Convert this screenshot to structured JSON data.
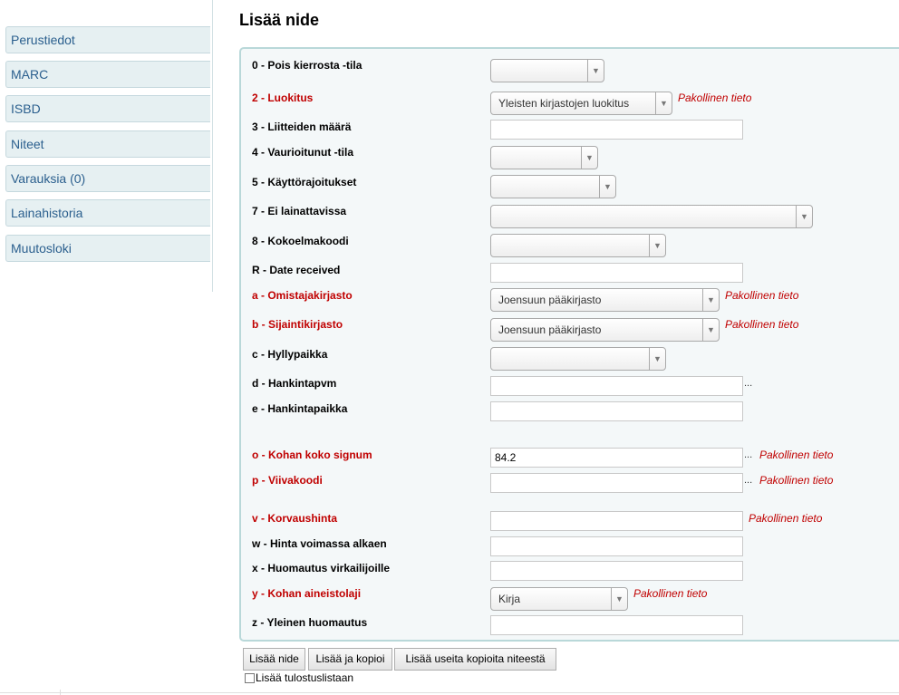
{
  "nav": {
    "items": [
      {
        "label": "Perustiedot"
      },
      {
        "label": "MARC"
      },
      {
        "label": "ISBD"
      },
      {
        "label": "Niteet"
      },
      {
        "label": "Varauksia (0)"
      },
      {
        "label": "Lainahistoria"
      },
      {
        "label": "Muutosloki"
      }
    ]
  },
  "page": {
    "title": "Lisää nide"
  },
  "required_note": "Pakollinen tieto",
  "dots": "...",
  "fields": {
    "f0": {
      "label": "0 - Pois kierrosta -tila",
      "value": ""
    },
    "f2": {
      "label": "2 - Luokitus",
      "value": "Yleisten kirjastojen luokitus"
    },
    "f3": {
      "label": "3 - Liitteiden määrä",
      "value": ""
    },
    "f4": {
      "label": "4 - Vaurioitunut -tila",
      "value": ""
    },
    "f5": {
      "label": "5 - Käyttörajoitukset",
      "value": ""
    },
    "f7": {
      "label": "7 - Ei lainattavissa",
      "value": ""
    },
    "f8": {
      "label": "8 - Kokoelmakoodi",
      "value": ""
    },
    "fR": {
      "label": "R - Date received",
      "value": ""
    },
    "fa": {
      "label": "a - Omistajakirjasto",
      "value": "Joensuun pääkirjasto"
    },
    "fb": {
      "label": "b - Sijaintikirjasto",
      "value": "Joensuun pääkirjasto"
    },
    "fc": {
      "label": "c - Hyllypaikka",
      "value": ""
    },
    "fd": {
      "label": "d - Hankintapvm",
      "value": ""
    },
    "fe": {
      "label": "e - Hankintapaikka",
      "value": ""
    },
    "fo": {
      "label": "o - Kohan koko signum",
      "value": "84.2"
    },
    "fp": {
      "label": "p - Viivakoodi",
      "value": ""
    },
    "fv": {
      "label": "v - Korvaushinta",
      "value": ""
    },
    "fw": {
      "label": "w - Hinta voimassa alkaen",
      "value": ""
    },
    "fx": {
      "label": "x - Huomautus virkailijoille",
      "value": ""
    },
    "fy": {
      "label": "y - Kohan aineistolaji",
      "value": "Kirja"
    },
    "fz": {
      "label": "z - Yleinen huomautus",
      "value": ""
    }
  },
  "buttons": {
    "add": "Lisää nide",
    "add_copy": "Lisää ja kopioi",
    "add_multiple": "Lisää useita kopioita niteestä"
  },
  "print_list": {
    "label": "Lisää tulostuslistaan",
    "checked": false
  }
}
